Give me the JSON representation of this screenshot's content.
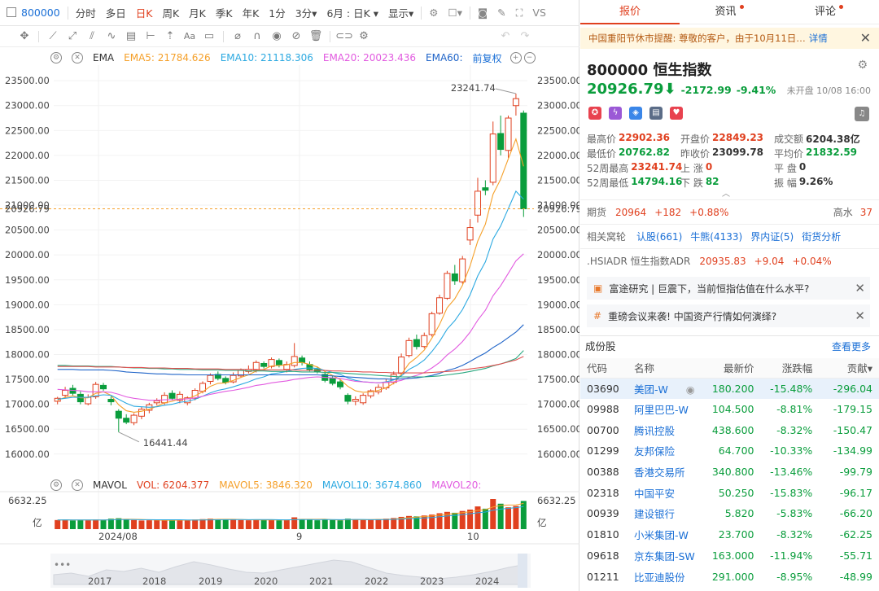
{
  "toolbar": {
    "code": "800000",
    "items": [
      "分时",
      "多日",
      "日K",
      "周K",
      "月K",
      "季K",
      "年K",
      "1分",
      "3分▾",
      "6月 : 日K ▾",
      "显示▾"
    ],
    "selected": "日K",
    "vs": "VS"
  },
  "indicator": {
    "name": "EMA",
    "ema5": "EMA5: 21784.626",
    "ema10": "EMA10: 21118.306",
    "ema20": "EMA20: 20023.436",
    "ema60": "EMA60:",
    "adjust": "前复权"
  },
  "volume": {
    "name": "MAVOL",
    "vol": "VOL: 6204.377",
    "mavol5": "MAVOL5: 3846.320",
    "mavol10": "MAVOL10: 3674.860",
    "mavol20": "MAVOL20:",
    "max": "6632.25",
    "unit": "亿"
  },
  "chart_data": {
    "type": "candlestick",
    "y_ticks": [
      "23500.00",
      "23000.00",
      "22500.00",
      "22000.00",
      "21500.00",
      "21000.00",
      "20500.00",
      "20000.00",
      "19500.00",
      "19000.00",
      "18500.00",
      "18000.00",
      "17500.00",
      "17000.00",
      "16500.00",
      "16000.00"
    ],
    "ylim": [
      15800,
      23650
    ],
    "x_labels": [
      "2024/08",
      "9",
      "10"
    ],
    "nav_years": [
      "2017",
      "2018",
      "2019",
      "2020",
      "2021",
      "2022",
      "2023",
      "2024"
    ],
    "high_label": "23241.74",
    "low_label": "16441.44",
    "last_label": "20926.79",
    "last": 20926.79,
    "candles": [
      [
        17060,
        17120,
        17000,
        17150
      ],
      [
        17180,
        17280,
        17120,
        17350
      ],
      [
        17320,
        17220,
        17180,
        17390
      ],
      [
        17200,
        17050,
        17000,
        17260
      ],
      [
        17010,
        17140,
        16980,
        17200
      ],
      [
        17150,
        17400,
        17110,
        17450
      ],
      [
        17380,
        17310,
        17270,
        17430
      ],
      [
        17100,
        17050,
        16980,
        17160
      ],
      [
        16860,
        16720,
        16441,
        16900
      ],
      [
        16720,
        16640,
        16600,
        16800
      ],
      [
        16630,
        16780,
        16580,
        16820
      ],
      [
        16760,
        16900,
        16700,
        16950
      ],
      [
        16880,
        16990,
        16820,
        17030
      ],
      [
        17030,
        17070,
        16980,
        17120
      ],
      [
        17030,
        17180,
        16990,
        17240
      ],
      [
        17220,
        17120,
        17080,
        17280
      ],
      [
        17080,
        17200,
        17020,
        17260
      ],
      [
        17030,
        17130,
        16980,
        17160
      ],
      [
        17120,
        17280,
        17080,
        17320
      ],
      [
        17260,
        17420,
        17220,
        17460
      ],
      [
        17460,
        17580,
        17400,
        17620
      ],
      [
        17600,
        17520,
        17480,
        17660
      ],
      [
        17520,
        17440,
        17400,
        17560
      ],
      [
        17450,
        17580,
        17420,
        17640
      ],
      [
        17570,
        17680,
        17530,
        17720
      ],
      [
        17660,
        17700,
        17620,
        17780
      ],
      [
        17690,
        17840,
        17640,
        17880
      ],
      [
        17820,
        17760,
        17720,
        17860
      ],
      [
        17760,
        17900,
        17720,
        17940
      ],
      [
        17880,
        17790,
        17740,
        17920
      ],
      [
        17700,
        17800,
        17640,
        17860
      ],
      [
        17780,
        17960,
        17740,
        18230
      ],
      [
        17930,
        17840,
        17780,
        17980
      ],
      [
        17800,
        17700,
        17660,
        17860
      ],
      [
        17700,
        17660,
        17620,
        17760
      ],
      [
        17600,
        17480,
        17440,
        17660
      ],
      [
        17520,
        17420,
        17380,
        17560
      ],
      [
        17450,
        17350,
        17300,
        17500
      ],
      [
        17180,
        17060,
        17000,
        17220
      ],
      [
        17060,
        17100,
        16980,
        17160
      ],
      [
        17030,
        17180,
        16990,
        17220
      ],
      [
        17170,
        17270,
        17120,
        17300
      ],
      [
        17250,
        17340,
        17200,
        17400
      ],
      [
        17330,
        17440,
        17290,
        17500
      ],
      [
        17440,
        17600,
        17400,
        17660
      ],
      [
        17620,
        17950,
        17580,
        18020
      ],
      [
        17980,
        18280,
        17940,
        18340
      ],
      [
        18300,
        18160,
        18100,
        18400
      ],
      [
        18160,
        18380,
        18120,
        18440
      ],
      [
        18400,
        18820,
        18360,
        18860
      ],
      [
        18830,
        19140,
        18800,
        19200
      ],
      [
        19130,
        19630,
        19100,
        19680
      ],
      [
        19620,
        19480,
        19400,
        19800
      ],
      [
        19460,
        19920,
        19420,
        19980
      ],
      [
        20300,
        20550,
        20200,
        20720
      ],
      [
        20800,
        21280,
        20650,
        21550
      ],
      [
        21350,
        21300,
        21200,
        21500
      ],
      [
        21460,
        22430,
        21400,
        22680
      ],
      [
        22440,
        22120,
        22000,
        22800
      ],
      [
        22100,
        22750,
        21950,
        22800
      ],
      [
        23000,
        23140,
        22800,
        23241
      ],
      [
        22849,
        20927,
        20763,
        22902
      ]
    ],
    "ema5": [
      17080,
      17140,
      17170,
      17130,
      17130,
      17220,
      17250,
      17180,
      16990,
      16870,
      16840,
      16860,
      16900,
      16960,
      17030,
      17060,
      17110,
      17110,
      17170,
      17250,
      17360,
      17420,
      17430,
      17480,
      17540,
      17590,
      17670,
      17700,
      17770,
      17780,
      17790,
      17840,
      17840,
      17800,
      17750,
      17660,
      17580,
      17500,
      17360,
      17270,
      17240,
      17250,
      17280,
      17330,
      17420,
      17600,
      17820,
      17940,
      18090,
      18330,
      18600,
      18940,
      19120,
      19390,
      19780,
      20280,
      20620,
      21220,
      21520,
      21930,
      22330,
      21780
    ],
    "ema10": [
      17100,
      17120,
      17140,
      17140,
      17140,
      17170,
      17190,
      17180,
      17100,
      17020,
      16960,
      16950,
      16940,
      16950,
      16980,
      17000,
      17040,
      17060,
      17100,
      17160,
      17230,
      17280,
      17310,
      17350,
      17400,
      17450,
      17510,
      17550,
      17610,
      17630,
      17660,
      17700,
      17720,
      17730,
      17720,
      17680,
      17640,
      17600,
      17530,
      17480,
      17450,
      17440,
      17430,
      17450,
      17490,
      17570,
      17700,
      17780,
      17890,
      18060,
      18260,
      18510,
      18680,
      18900,
      19200,
      19580,
      19860,
      20320,
      20580,
      20930,
      21280,
      21118
    ],
    "ema20": [
      17300,
      17290,
      17280,
      17270,
      17250,
      17250,
      17250,
      17240,
      17200,
      17150,
      17120,
      17100,
      17080,
      17080,
      17090,
      17090,
      17100,
      17110,
      17130,
      17160,
      17200,
      17230,
      17260,
      17280,
      17310,
      17340,
      17380,
      17400,
      17430,
      17450,
      17470,
      17500,
      17520,
      17540,
      17550,
      17540,
      17530,
      17520,
      17490,
      17460,
      17450,
      17440,
      17430,
      17440,
      17450,
      17480,
      17540,
      17580,
      17640,
      17730,
      17840,
      17990,
      18110,
      18260,
      18450,
      18690,
      18890,
      19180,
      19380,
      19630,
      19880,
      20023
    ],
    "ema60": [
      17700,
      17700,
      17700,
      17690,
      17690,
      17690,
      17690,
      17680,
      17670,
      17650,
      17640,
      17630,
      17620,
      17610,
      17610,
      17600,
      17600,
      17590,
      17590,
      17590,
      17590,
      17590,
      17590,
      17590,
      17590,
      17590,
      17590,
      17590,
      17590,
      17590,
      17590,
      17590,
      17590,
      17590,
      17590,
      17580,
      17570,
      17560,
      17550,
      17540,
      17530,
      17520,
      17510,
      17510,
      17500,
      17510,
      17520,
      17530,
      17550,
      17580,
      17620,
      17680,
      17720,
      17780,
      17860,
      17950,
      18030,
      18140,
      18230,
      18340,
      18450,
      18600
    ],
    "ema120": [
      17780,
      17780,
      17770,
      17770,
      17770,
      17760,
      17760,
      17760,
      17750,
      17740,
      17730,
      17730,
      17720,
      17720,
      17710,
      17710,
      17700,
      17700,
      17700,
      17690,
      17690,
      17690,
      17680,
      17680,
      17680,
      17670,
      17670,
      17670,
      17660,
      17660,
      17660,
      17660,
      17650,
      17650,
      17650,
      17640,
      17640,
      17630,
      17620,
      17610,
      17600,
      17590,
      17580,
      17570,
      17560,
      17550,
      17550,
      17550,
      17550,
      17560,
      17570,
      17590,
      17610,
      17630,
      17660,
      17690,
      17720,
      17770,
      17810,
      17860,
      17920,
      18080
    ],
    "ema250": [
      17760,
      17760,
      17760,
      17760,
      17760,
      17750,
      17750,
      17750,
      17750,
      17740,
      17740,
      17740,
      17730,
      17730,
      17730,
      17720,
      17720,
      17720,
      17710,
      17710,
      17710,
      17710,
      17700,
      17700,
      17700,
      17700,
      17700,
      17690,
      17690,
      17690,
      17690,
      17690,
      17680,
      17680,
      17680,
      17680,
      17670,
      17670,
      17660,
      17660,
      17650,
      17650,
      17640,
      17640,
      17630,
      17630,
      17630,
      17630,
      17630,
      17640,
      17650,
      17660,
      17670,
      17690,
      17710,
      17730,
      17750,
      17780,
      17810,
      17850,
      17890,
      17960
    ],
    "volumes": [
      2000,
      2100,
      1900,
      2050,
      1950,
      2100,
      2000,
      2300,
      2400,
      2100,
      2000,
      1900,
      1950,
      2000,
      1900,
      2050,
      1950,
      2000,
      2100,
      2200,
      2300,
      2200,
      2050,
      2100,
      2000,
      1950,
      2100,
      2000,
      2050,
      1950,
      2000,
      2600,
      2200,
      2050,
      1950,
      2100,
      2000,
      1950,
      2300,
      2100,
      2000,
      2150,
      2200,
      2300,
      2450,
      2700,
      2900,
      2800,
      3000,
      3200,
      3500,
      3800,
      3600,
      4000,
      4300,
      5000,
      4500,
      6632,
      5600,
      4800,
      5100,
      6204
    ]
  },
  "tabs": [
    "报价",
    "资讯",
    "评论"
  ],
  "notice": {
    "text": "中国重阳节休市提醒: 尊敬的客户，由于10月11日…",
    "link": "详情"
  },
  "quote": {
    "code": "800000",
    "name": "恒生指数",
    "price": "20926.79",
    "change": "-2172.99",
    "pct": "-9.41%",
    "status": "未开盘 10/08 16:00",
    "rows": [
      [
        [
          "最高价",
          "22902.36",
          "red"
        ],
        [
          "开盘价",
          "22849.23",
          "red"
        ],
        [
          "成交额",
          "6204.38亿",
          ""
        ]
      ],
      [
        [
          "最低价",
          "20762.82",
          "green"
        ],
        [
          "昨收价",
          "23099.78",
          ""
        ],
        [
          "平均价",
          "21832.59",
          "green"
        ]
      ],
      [
        [
          "52周最高",
          "23241.74",
          "red"
        ],
        [
          "上 涨",
          "0",
          "red"
        ],
        [
          "平 盘",
          "0",
          ""
        ]
      ],
      [
        [
          "52周最低",
          "14794.16",
          "green"
        ],
        [
          "下 跌",
          "82",
          "green"
        ],
        [
          "振 幅",
          "9.26%",
          ""
        ]
      ]
    ]
  },
  "futures": {
    "label": "期货",
    "price": "20964",
    "chg": "+182",
    "pct": "+0.88%",
    "hw_label": "高水",
    "hw": "37"
  },
  "warrants": {
    "label": "相关窝轮",
    "items": [
      "认股(661)",
      "牛熊(4133)",
      "界内证(5)",
      "街货分析"
    ]
  },
  "adr": {
    "label": ".HSIADR 恒生指数ADR",
    "price": "20935.83",
    "chg": "+9.04",
    "pct": "+0.04%"
  },
  "news": [
    "富途研究 | 巨震下，当前恒指估值在什么水平?",
    "重磅会议来袭! 中国资产行情如何演绎?"
  ],
  "constituents": {
    "title": "成份股",
    "more": "查看更多",
    "headers": [
      "代码",
      "名称",
      "最新价",
      "涨跌幅",
      "贡献▾"
    ],
    "rows": [
      [
        "03690",
        "美团-W",
        "180.200",
        "-15.48%",
        "-296.04"
      ],
      [
        "09988",
        "阿里巴巴-W",
        "104.500",
        "-8.81%",
        "-179.15"
      ],
      [
        "00700",
        "腾讯控股",
        "438.600",
        "-8.32%",
        "-150.47"
      ],
      [
        "01299",
        "友邦保险",
        "64.700",
        "-10.33%",
        "-134.99"
      ],
      [
        "00388",
        "香港交易所",
        "340.800",
        "-13.46%",
        "-99.79"
      ],
      [
        "02318",
        "中国平安",
        "50.250",
        "-15.83%",
        "-96.17"
      ],
      [
        "00939",
        "建设银行",
        "5.820",
        "-5.83%",
        "-66.20"
      ],
      [
        "01810",
        "小米集团-W",
        "23.700",
        "-8.32%",
        "-62.25"
      ],
      [
        "09618",
        "京东集团-SW",
        "163.000",
        "-11.94%",
        "-55.71"
      ],
      [
        "01211",
        "比亚迪股份",
        "291.000",
        "-8.95%",
        "-48.99"
      ]
    ]
  },
  "colors": {
    "up": "#e0401f",
    "down": "#0a9d3c",
    "ema5": "#f5a02a",
    "ema10": "#2ca9e1",
    "ema20": "#e25be0",
    "ema60": "#1f64c8",
    "ema120": "#2aa880",
    "ema250": "#e05050"
  }
}
